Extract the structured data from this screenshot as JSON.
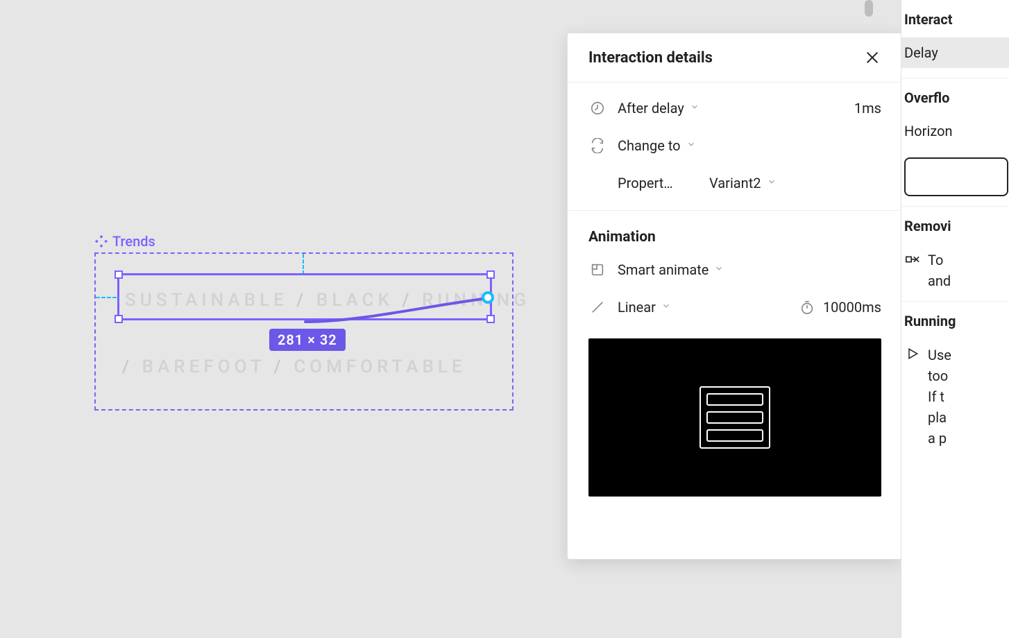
{
  "canvas": {
    "frame_label": "Trends",
    "row1_parts": [
      "SUSTAINABLE",
      "/",
      "BLACK",
      "/",
      "RUNNING"
    ],
    "row2_parts": [
      "/",
      "BAREFOOT",
      "/",
      "COMFORTABLE"
    ],
    "dimensions_badge": "281 × 32"
  },
  "panel": {
    "title": "Interaction details",
    "trigger": {
      "label": "After delay",
      "value": "1ms"
    },
    "action": {
      "label": "Change to"
    },
    "property": {
      "label": "Propert…",
      "value": "Variant2"
    },
    "animation_title": "Animation",
    "animate": {
      "label": "Smart animate"
    },
    "easing": {
      "label": "Linear",
      "duration": "10000ms"
    }
  },
  "sidebar": {
    "interactions_heading": "Interact",
    "delay_label": "Delay",
    "overflow_heading": "Overflo",
    "overflow_value": "Horizon",
    "removing_heading": "Removi",
    "removing_lines": [
      "To",
      "and"
    ],
    "running_heading": "Running",
    "running_lines": [
      "Use",
      "too",
      "If t",
      "pla",
      "a p"
    ]
  }
}
